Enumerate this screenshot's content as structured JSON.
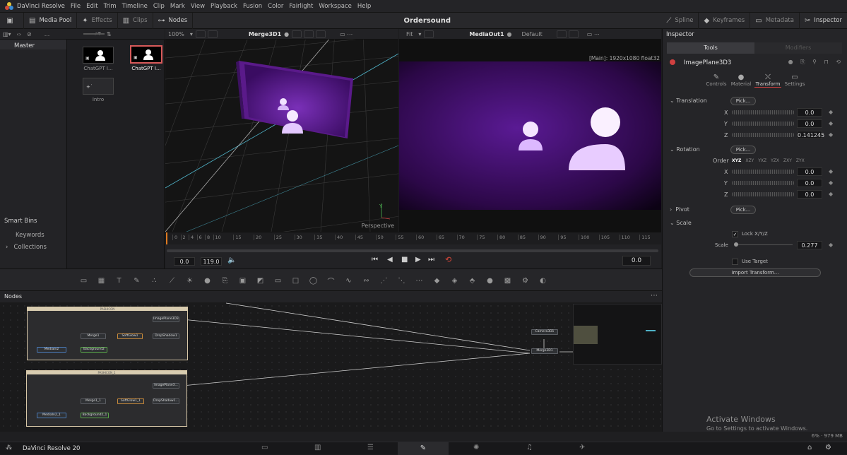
{
  "menubar": {
    "app": "DaVinci Resolve",
    "items": [
      "File",
      "Edit",
      "Trim",
      "Timeline",
      "Clip",
      "Mark",
      "View",
      "Playback",
      "Fusion",
      "Color",
      "Fairlight",
      "Workspace",
      "Help"
    ]
  },
  "toolbar": {
    "media_pool": "Media Pool",
    "effects": "Effects",
    "clips": "Clips",
    "nodes": "Nodes",
    "project": "Ordersound",
    "spline": "Spline",
    "keyframes": "Keyframes",
    "metadata": "Metadata",
    "inspector": "Inspector"
  },
  "subbar": {
    "zoom": "100%",
    "viewer1": "Merge3D1",
    "fit": "Fit",
    "viewer2": "MediaOut1",
    "default": "Default",
    "ellipsis": "..."
  },
  "left": {
    "master": "Master",
    "smart_bins": "Smart Bins",
    "keywords": "Keywords",
    "collections": "Collections"
  },
  "media": {
    "items": [
      "ChatGPT I...",
      "ChatGPT I...",
      "Intro"
    ]
  },
  "viewer1": {
    "label": "Perspective",
    "axis_y": "Y"
  },
  "viewer2": {
    "info": "[Main]: 1920x1080 float32"
  },
  "ruler": {
    "ticks": [
      "0",
      "2",
      "4",
      "6",
      "8",
      "10",
      "15",
      "20",
      "25",
      "30",
      "35",
      "40",
      "45",
      "50",
      "55",
      "60",
      "65",
      "70",
      "75",
      "80",
      "85",
      "90",
      "95",
      "100",
      "105",
      "110",
      "115"
    ]
  },
  "transport": {
    "start": "0.0",
    "end": "119.0",
    "current": "0.0"
  },
  "nodes": {
    "title": "Nodes",
    "group1": "PASHICON",
    "group2": "PASHICON_1",
    "n_imageplane": "ImagePlane3D3",
    "n_merge1": "Merge1",
    "n_softglow": "SoftGlow1",
    "n_dropshadow": "DropShadow1",
    "n_media": "MediaIn2",
    "n_bg": "Background2",
    "n_imageplane2": "ImagePlane3...",
    "n_merge1_1": "Merge1_1",
    "n_softglow_1": "SoftGlow1_1",
    "n_dropshadow_1": "DropShadow1...",
    "n_media2_1": "MediaIn2_1",
    "n_bg2_1": "Background2_1",
    "n_camera": "Camera3D1",
    "n_merge3d": "Merge3D1"
  },
  "inspector": {
    "title": "Inspector",
    "tab_tools": "Tools",
    "tab_modifiers": "Modifiers",
    "node": "ImagePlane3D3",
    "sub_controls": "Controls",
    "sub_material": "Material",
    "sub_transform": "Transform",
    "sub_settings": "Settings",
    "translation": "Translation",
    "pick": "Pick...",
    "x": "X",
    "y": "Y",
    "z": "Z",
    "tx": "0.0",
    "ty": "0.0",
    "tz": "0.141245",
    "rotation": "Rotation",
    "order": "Order",
    "orders": [
      "XYZ",
      "XZY",
      "YXZ",
      "YZX",
      "ZXY",
      "ZYX"
    ],
    "rx": "0.0",
    "ry": "0.0",
    "rz": "0.0",
    "pivot": "Pivot",
    "scale": "Scale",
    "lock": "Lock X/Y/Z",
    "scale_label": "Scale",
    "scale_value": "0.277",
    "use_target": "Use Target",
    "import": "Import Transform..."
  },
  "watermark": {
    "title": "Activate Windows",
    "sub": "Go to Settings to activate Windows."
  },
  "status": {
    "memory": "6% · 979 MB"
  },
  "pagebar": {
    "app": "DaVinci Resolve 20"
  }
}
